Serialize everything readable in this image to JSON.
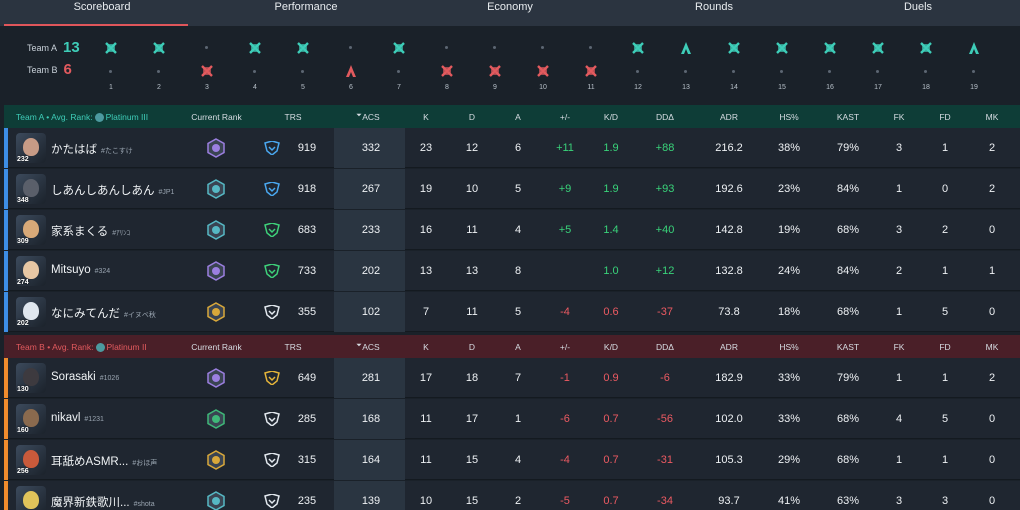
{
  "tabs": [
    {
      "label": "Scoreboard",
      "active": true
    },
    {
      "label": "Performance",
      "active": false
    },
    {
      "label": "Economy",
      "active": false
    },
    {
      "label": "Rounds",
      "active": false
    },
    {
      "label": "Duels",
      "active": false
    }
  ],
  "score": {
    "team_a": {
      "label": "Team A",
      "rounds": "13",
      "color": "#3ecdb8"
    },
    "team_b": {
      "label": "Team B",
      "rounds": "6",
      "color": "#e25a5e"
    }
  },
  "rounds": [
    {
      "n": "1",
      "winner": "A",
      "type": "elim"
    },
    {
      "n": "2",
      "winner": "A",
      "type": "elim"
    },
    {
      "n": "3",
      "winner": "B",
      "type": "elim"
    },
    {
      "n": "4",
      "winner": "A",
      "type": "elim"
    },
    {
      "n": "5",
      "winner": "A",
      "type": "elim"
    },
    {
      "n": "6",
      "winner": "B",
      "type": "spike"
    },
    {
      "n": "7",
      "winner": "A",
      "type": "elim"
    },
    {
      "n": "8",
      "winner": "B",
      "type": "elim"
    },
    {
      "n": "9",
      "winner": "B",
      "type": "elim"
    },
    {
      "n": "10",
      "winner": "B",
      "type": "elim"
    },
    {
      "n": "11",
      "winner": "B",
      "type": "elim"
    },
    {
      "n": "12",
      "winner": "A",
      "type": "elim"
    },
    {
      "n": "13",
      "winner": "A",
      "type": "spike"
    },
    {
      "n": "14",
      "winner": "A",
      "type": "elim"
    },
    {
      "n": "15",
      "winner": "A",
      "type": "elim"
    },
    {
      "n": "16",
      "winner": "A",
      "type": "elim"
    },
    {
      "n": "17",
      "winner": "A",
      "type": "elim"
    },
    {
      "n": "18",
      "winner": "A",
      "type": "elim"
    },
    {
      "n": "19",
      "winner": "A",
      "type": "spike"
    }
  ],
  "headers": {
    "current_rank": "Current Rank",
    "trs": "TRS",
    "acs": "ACS",
    "sort_arrow": "⏷",
    "k": "K",
    "d": "D",
    "a": "A",
    "pm": "+/-",
    "kd": "K/D",
    "dd": "DDΔ",
    "adr": "ADR",
    "hs": "HS%",
    "kast": "KAST",
    "fk": "FK",
    "fd": "FD",
    "mk": "MK"
  },
  "team_a": {
    "label": "Team A",
    "bullet": "•",
    "avg_rank_label": "Avg. Rank:",
    "avg_rank": "Platinum III",
    "players": [
      {
        "level": "232",
        "name": "かたはば",
        "tag": "#たこすけ",
        "rank": "purple",
        "trs_tier": "blue",
        "face": "#c79b86",
        "trs": "919",
        "acs": "332",
        "k": "23",
        "d": "12",
        "a": "6",
        "pm": "+11",
        "kd": "1.9",
        "dd": "+88",
        "adr": "216.2",
        "hs": "38%",
        "kast": "79%",
        "fk": "3",
        "fd": "1",
        "mk": "2"
      },
      {
        "level": "348",
        "name": "しあんしあんしあん",
        "tag": "#JP1",
        "rank": "teal",
        "trs_tier": "blue",
        "face": "#5a5f6a",
        "trs": "918",
        "acs": "267",
        "k": "19",
        "d": "10",
        "a": "5",
        "pm": "+9",
        "kd": "1.9",
        "dd": "+93",
        "adr": "192.6",
        "hs": "23%",
        "kast": "84%",
        "fk": "1",
        "fd": "0",
        "mk": "2"
      },
      {
        "level": "309",
        "name": "家系まくる",
        "tag": "#ｱﾘﾝｺ",
        "rank": "teal",
        "trs_tier": "green",
        "face": "#d8a978",
        "trs": "683",
        "acs": "233",
        "k": "16",
        "d": "11",
        "a": "4",
        "pm": "+5",
        "kd": "1.4",
        "dd": "+40",
        "adr": "142.8",
        "hs": "19%",
        "kast": "68%",
        "fk": "3",
        "fd": "2",
        "mk": "0"
      },
      {
        "level": "274",
        "name": "Mitsuyo",
        "tag": "#324",
        "rank": "purple",
        "trs_tier": "green",
        "face": "#e7c7a4",
        "trs": "733",
        "acs": "202",
        "k": "13",
        "d": "13",
        "a": "8",
        "pm": "",
        "kd": "1.0",
        "dd": "+12",
        "adr": "132.8",
        "hs": "24%",
        "kast": "84%",
        "fk": "2",
        "fd": "1",
        "mk": "1"
      },
      {
        "level": "202",
        "name": "なにみてんだ",
        "tag": "#イヌベ秋",
        "rank": "gold",
        "trs_tier": "white",
        "face": "#dfe6ee",
        "trs": "355",
        "acs": "102",
        "k": "7",
        "d": "11",
        "a": "5",
        "pm": "-4",
        "kd": "0.6",
        "dd": "-37",
        "adr": "73.8",
        "hs": "18%",
        "kast": "68%",
        "fk": "1",
        "fd": "5",
        "mk": "0"
      }
    ]
  },
  "team_b": {
    "label": "Team B",
    "bullet": "•",
    "avg_rank_label": "Avg. Rank:",
    "avg_rank": "Platinum II",
    "players": [
      {
        "level": "130",
        "name": "Sorasaki",
        "tag": "#1026",
        "rank": "purple",
        "trs_tier": "gold",
        "face": "#3d3a3f",
        "trs": "649",
        "acs": "281",
        "k": "17",
        "d": "18",
        "a": "7",
        "pm": "-1",
        "kd": "0.9",
        "dd": "-6",
        "adr": "182.9",
        "hs": "33%",
        "kast": "79%",
        "fk": "1",
        "fd": "1",
        "mk": "2"
      },
      {
        "level": "160",
        "name": "nikavl",
        "tag": "#1231",
        "rank": "green",
        "trs_tier": "white",
        "face": "#8a6a4e",
        "trs": "285",
        "acs": "168",
        "k": "11",
        "d": "17",
        "a": "1",
        "pm": "-6",
        "kd": "0.7",
        "dd": "-56",
        "adr": "102.0",
        "hs": "33%",
        "kast": "68%",
        "fk": "4",
        "fd": "5",
        "mk": "0"
      },
      {
        "level": "256",
        "name": "耳舐めASMR...",
        "tag": "#おほ声",
        "rank": "gold",
        "trs_tier": "white",
        "face": "#c95a3b",
        "trs": "315",
        "acs": "164",
        "k": "11",
        "d": "15",
        "a": "4",
        "pm": "-4",
        "kd": "0.7",
        "dd": "-31",
        "adr": "105.3",
        "hs": "29%",
        "kast": "68%",
        "fk": "1",
        "fd": "1",
        "mk": "0"
      },
      {
        "level": "",
        "name": "魔界新鉄歌川...",
        "tag": "#shota",
        "rank": "teal",
        "trs_tier": "white",
        "face": "#e0c35a",
        "trs": "235",
        "acs": "139",
        "k": "10",
        "d": "15",
        "a": "2",
        "pm": "-5",
        "kd": "0.7",
        "dd": "-34",
        "adr": "93.7",
        "hs": "41%",
        "kast": "63%",
        "fk": "3",
        "fd": "3",
        "mk": "0"
      }
    ]
  },
  "colors": {
    "team_a_accent": "#3ecdb8",
    "team_b_accent": "#e25a5e",
    "positive": "#39d37a",
    "negative": "#ec5a62",
    "rank_purple": "#9b7fe0",
    "rank_teal": "#56b8c4",
    "rank_gold": "#d9a83a",
    "rank_green": "#3fb879"
  }
}
